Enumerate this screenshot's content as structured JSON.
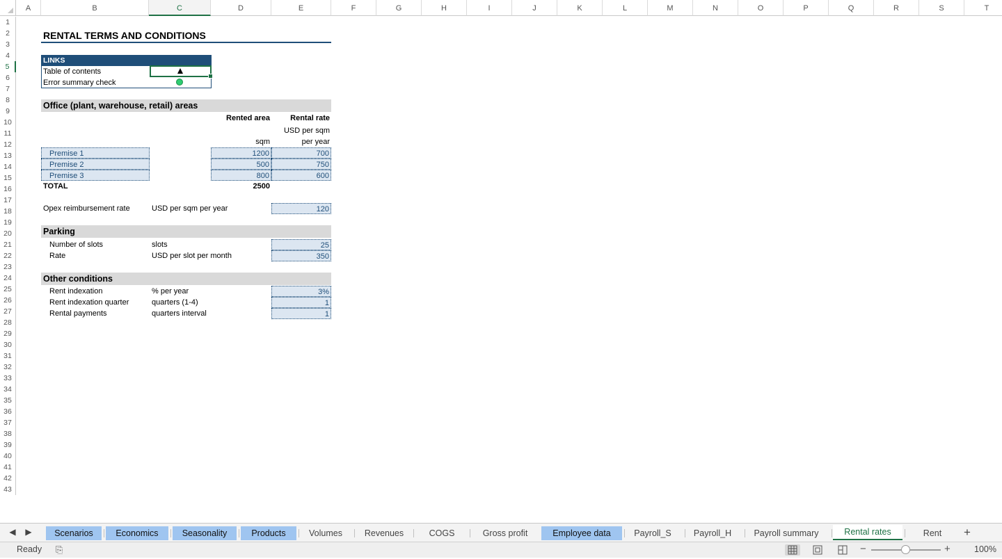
{
  "columns": [
    "A",
    "B",
    "C",
    "D",
    "E",
    "F",
    "G",
    "H",
    "I",
    "J",
    "K",
    "L",
    "M",
    "N",
    "O",
    "P",
    "Q",
    "R",
    "S",
    "T"
  ],
  "active_column": "C",
  "rows": [
    "1",
    "2",
    "3",
    "4",
    "5",
    "6",
    "7",
    "8",
    "9",
    "10",
    "11",
    "12",
    "13",
    "14",
    "15",
    "16",
    "17",
    "18",
    "19",
    "20",
    "21",
    "22",
    "23",
    "24",
    "25",
    "26",
    "27",
    "28",
    "29",
    "30",
    "31",
    "32",
    "33",
    "34",
    "35",
    "36",
    "37",
    "38",
    "39",
    "40",
    "41",
    "42",
    "43"
  ],
  "active_row": "5",
  "sheet": {
    "title": "RENTAL TERMS AND CONDITIONS",
    "links": {
      "header": "LINKS",
      "toc_label": "Table of contents",
      "error_label": "Error summary check"
    },
    "office": {
      "section": "Office (plant, warehouse, retail) areas",
      "col_area": "Rented area",
      "col_rate": "Rental rate",
      "rate_unit_1": "USD per sqm",
      "area_unit": "sqm",
      "rate_unit_2": "per year",
      "premises": [
        {
          "name": "Premise 1",
          "area": "1200",
          "rate": "700"
        },
        {
          "name": "Premise 2",
          "area": "500",
          "rate": "750"
        },
        {
          "name": "Premise 3",
          "area": "800",
          "rate": "600"
        }
      ],
      "total_label": "TOTAL",
      "total_area": "2500"
    },
    "opex": {
      "label": "Opex reimbursement rate",
      "unit": "USD per sqm per year",
      "value": "120"
    },
    "parking": {
      "section": "Parking",
      "slots_label": "Number of slots",
      "slots_unit": "slots",
      "slots_value": "25",
      "rate_label": "Rate",
      "rate_unit": "USD per slot per month",
      "rate_value": "350"
    },
    "other": {
      "section": "Other conditions",
      "index_label": "Rent indexation",
      "index_unit": "% per year",
      "index_value": "3%",
      "quarter_label": "Rent indexation quarter",
      "quarter_unit": "quarters (1-4)",
      "quarter_value": "1",
      "payments_label": "Rental payments",
      "payments_unit": "quarters interval",
      "payments_value": "1"
    }
  },
  "tabs": [
    "Scenarios",
    "Economics",
    "Seasonality",
    "Products",
    "Volumes",
    "Revenues",
    "COGS",
    "Gross profit",
    "Employee data",
    "Payroll_S",
    "Payroll_H",
    "Payroll summary",
    "Rental rates",
    "Rent"
  ],
  "active_tab": "Rental rates",
  "status": {
    "text": "Ready",
    "zoom": "100%"
  },
  "colors": {
    "accent": "#1e7145",
    "header_blue": "#1f4e79",
    "input_fill": "#dce6f1",
    "tab_highlight": "#9fc5f0"
  }
}
